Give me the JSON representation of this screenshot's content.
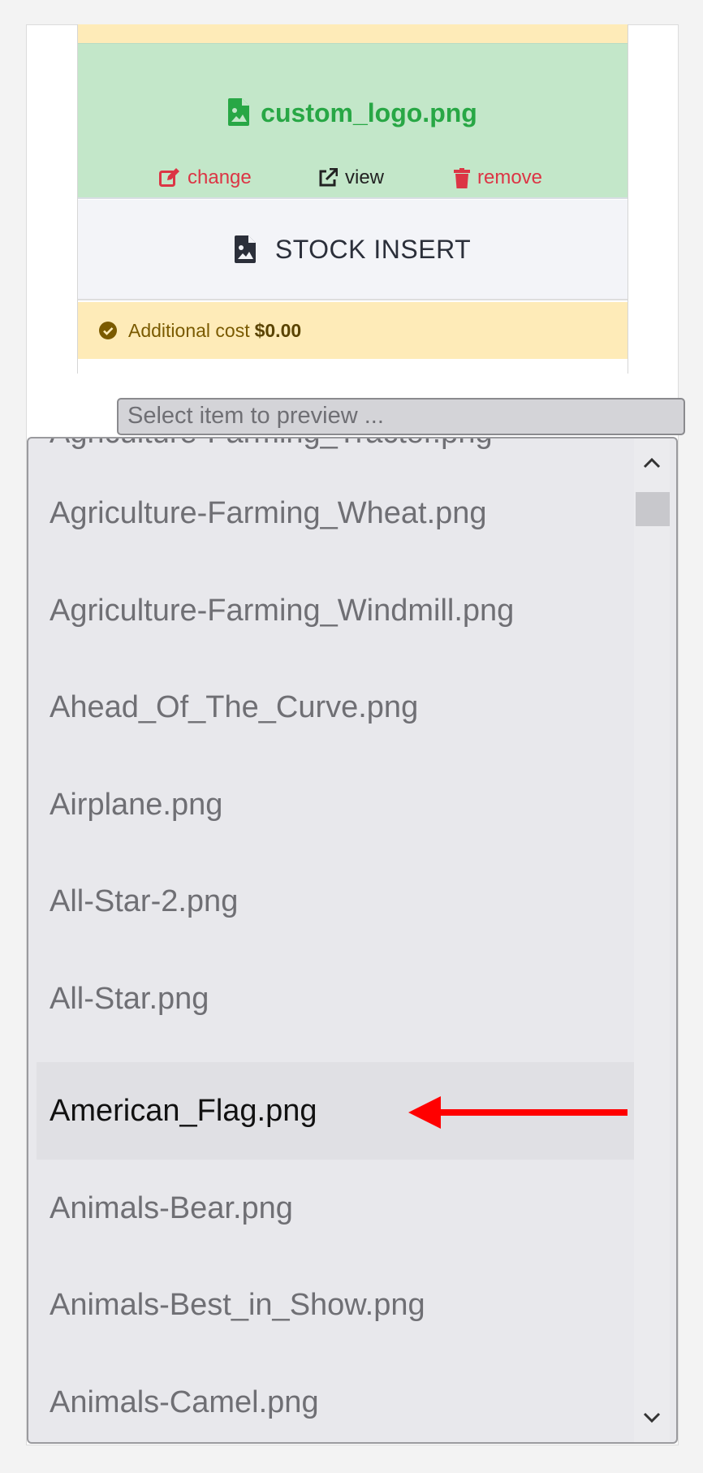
{
  "file": {
    "name": "custom_logo.png",
    "actions": {
      "change": "change",
      "view": "view",
      "remove": "remove"
    }
  },
  "stock": {
    "label": "STOCK INSERT"
  },
  "notice": {
    "text": "Additional cost",
    "amount": "$0.00"
  },
  "select": {
    "placeholder": "Select item to preview ..."
  },
  "dropdown": {
    "partial_item": "Agriculture-Farming_Tractor.png",
    "items": [
      "Agriculture-Farming_Wheat.png",
      "Agriculture-Farming_Windmill.png",
      "Ahead_Of_The_Curve.png",
      "Airplane.png",
      "All-Star-2.png",
      "All-Star.png",
      "American_Flag.png",
      "Animals-Bear.png",
      "Animals-Best_in_Show.png",
      "Animals-Camel.png"
    ],
    "highlighted_index": 6
  },
  "colors": {
    "success": "#28a745",
    "danger": "#dc3545",
    "warning_bg": "#feebb8",
    "arrow": "#ff0000"
  },
  "icons": {
    "file": "file-image-icon",
    "change": "edit-icon",
    "view": "external-link-icon",
    "remove": "trash-icon",
    "check": "check-circle-icon",
    "pointer": "red-arrow-annotation"
  }
}
